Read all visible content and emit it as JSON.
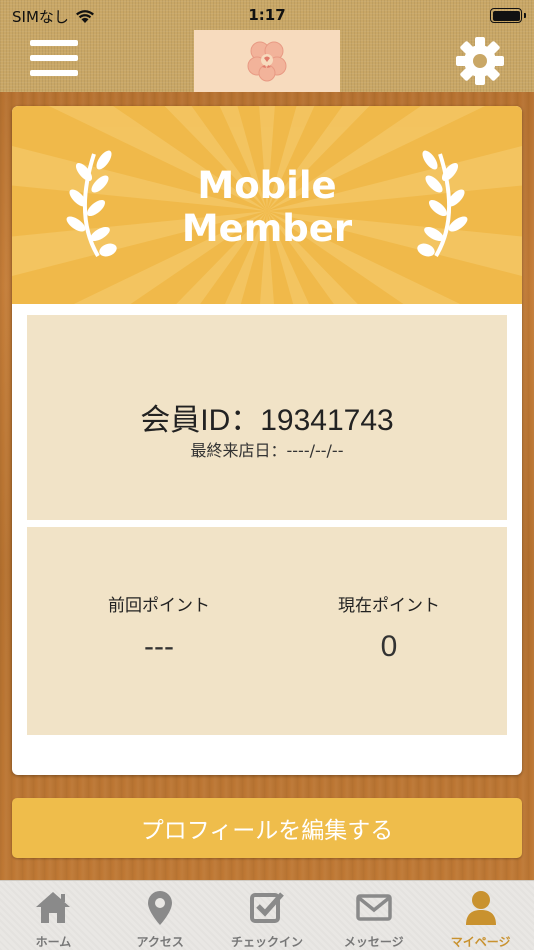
{
  "status_bar": {
    "carrier": "SIMなし",
    "time": "1:17"
  },
  "header": {
    "logo_icon": "clover-flower-icon",
    "menu_icon": "hamburger-icon",
    "settings_icon": "gear-icon"
  },
  "banner": {
    "title_line1": "Mobile",
    "title_line2": "Member"
  },
  "member": {
    "id_text": "会員ID：19341743",
    "last_visit": "最終来店日：----/--/--"
  },
  "points": {
    "previous_label": "前回ポイント",
    "previous_value": "---",
    "current_label": "現在ポイント",
    "current_value": "0"
  },
  "edit_profile_button": "プロフィールを編集する",
  "tabs": [
    {
      "label": "ホーム",
      "icon": "home-icon"
    },
    {
      "label": "アクセス",
      "icon": "map-pin-icon"
    },
    {
      "label": "チェックイン",
      "icon": "checkbox-icon"
    },
    {
      "label": "メッセージ",
      "icon": "envelope-icon"
    },
    {
      "label": "マイページ",
      "icon": "person-icon",
      "active": true
    }
  ],
  "colors": {
    "accent": "#efbd4b",
    "active_tab": "#c9922f",
    "panel": "#f1e3c7"
  }
}
